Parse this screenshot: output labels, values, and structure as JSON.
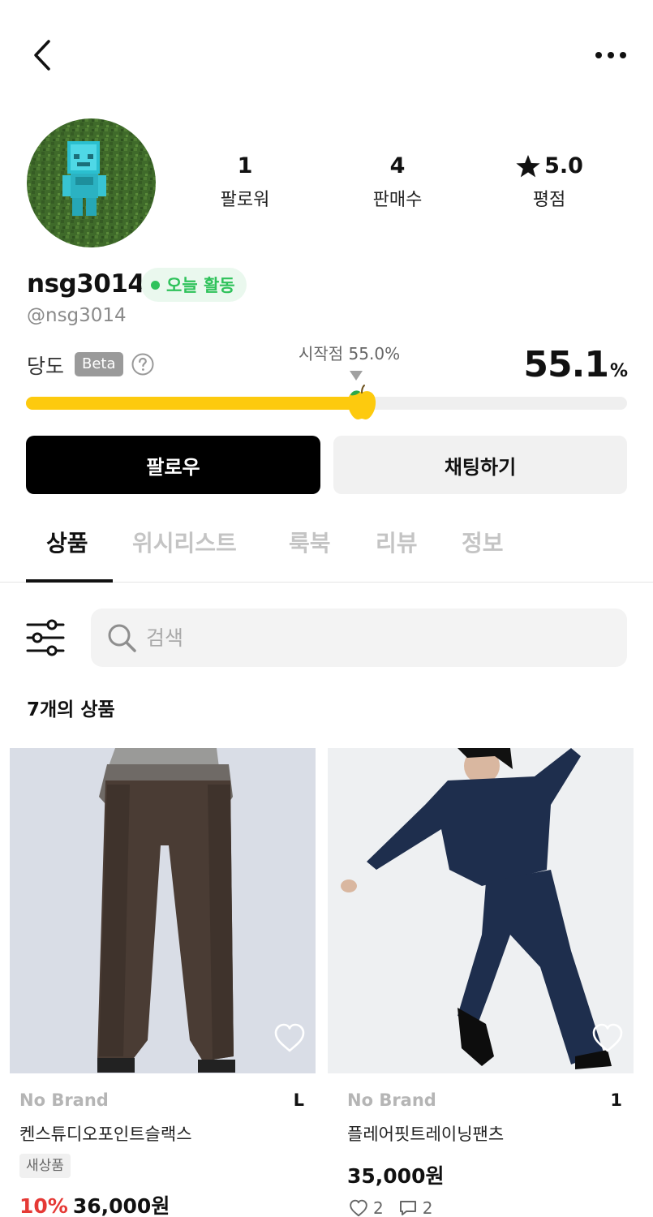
{
  "header": {
    "back_icon": "chevron-left-icon",
    "more_icon": "more-horizontal-icon"
  },
  "profile": {
    "avatar_icon": "minecraft-avatar",
    "stats": [
      {
        "value": "1",
        "label": "팔로워"
      },
      {
        "value": "4",
        "label": "판매수"
      },
      {
        "value": "5.0",
        "label": "평점",
        "icon": "star-icon"
      }
    ],
    "username": "nsg3014",
    "active_label": "오늘 활동",
    "active_color": "#2fc25b",
    "handle": "@nsg3014"
  },
  "sweetness": {
    "label": "당도",
    "beta": "Beta",
    "start_label": "시작점 55.0%",
    "start_value": 55.0,
    "value": "55.1",
    "value_number": 55.1,
    "unit": "%",
    "bar_color": "#fdca0e"
  },
  "actions": {
    "follow": "팔로우",
    "chat": "채팅하기"
  },
  "tabs": [
    {
      "label": "상품",
      "active": true
    },
    {
      "label": "위시리스트",
      "active": false
    },
    {
      "label": "룩북",
      "active": false
    },
    {
      "label": "리뷰",
      "active": false
    },
    {
      "label": "정보",
      "active": false
    }
  ],
  "search": {
    "placeholder": "검색",
    "value": ""
  },
  "product_count": "7개의 상품",
  "products": [
    {
      "brand": "No Brand",
      "size": "L",
      "name": "켄스튜디오포인트슬랙스",
      "condition": "새상품",
      "discount": "10%",
      "price": "36,000원"
    },
    {
      "brand": "No Brand",
      "size": "1",
      "name": "플레어핏트레이닝팬츠",
      "price": "35,000원",
      "likes": "2",
      "comments": "2"
    }
  ]
}
